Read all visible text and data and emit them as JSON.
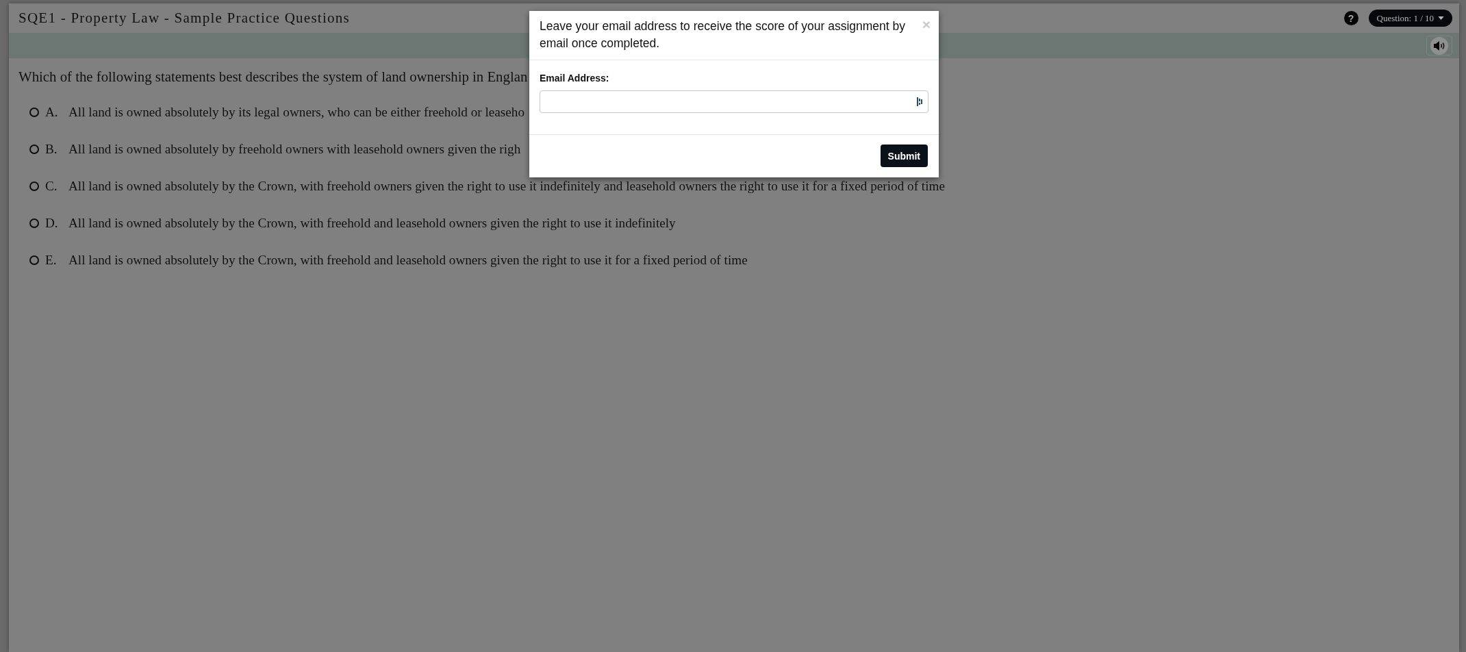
{
  "header": {
    "title": "SQE1 - Property Law - Sample Practice Questions",
    "help_button": {
      "label": "?"
    },
    "question_menu": {
      "label": "Question: 1 / 10"
    }
  },
  "question": {
    "text": "Which of the following statements best describes the system of land ownership in Englan",
    "options": [
      {
        "letter": "A.",
        "text": "All land is owned absolutely by its legal owners, who can be either freehold or leaseho",
        "selected": false
      },
      {
        "letter": "B.",
        "text": "All land is owned absolutely by freehold owners with leasehold owners given the righ",
        "selected": false
      },
      {
        "letter": "C.",
        "text": "All land is owned absolutely by the Crown, with freehold owners given the right to use it indefinitely and leasehold owners the right to use it for a fixed period of time",
        "selected": false
      },
      {
        "letter": "D.",
        "text": "All land is owned absolutely by the Crown, with freehold and leasehold owners given the right to use it indefinitely",
        "selected": false
      },
      {
        "letter": "E.",
        "text": "All land is owned absolutely by the Crown, with freehold and leasehold owners given the right to use it for a fixed period of time",
        "selected": false
      }
    ]
  },
  "modal": {
    "message": "Leave your email address to receive the score of your assignment by email once completed.",
    "close": "×",
    "email_label": "Email Address:",
    "submit": "Submit"
  }
}
